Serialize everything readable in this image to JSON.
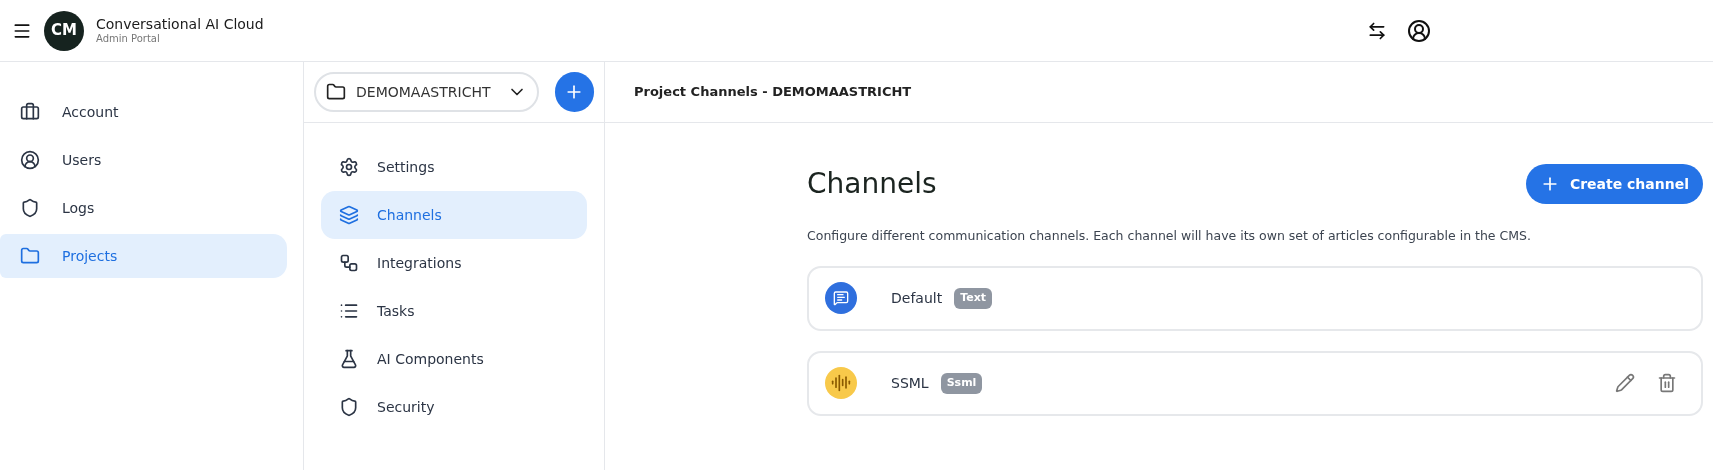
{
  "header": {
    "title": "Conversational AI Cloud",
    "subtitle": "Admin Portal",
    "logo": "CM"
  },
  "sidebar": {
    "items": [
      {
        "label": "Account",
        "kind": "briefcase",
        "selected": false
      },
      {
        "label": "Users",
        "kind": "user",
        "selected": false
      },
      {
        "label": "Logs",
        "kind": "shield",
        "selected": false
      },
      {
        "label": "Projects",
        "kind": "folder",
        "selected": true
      }
    ]
  },
  "project_selector": {
    "value": "DEMOMAASTRICHT"
  },
  "project_menu": {
    "items": [
      {
        "label": "Settings",
        "kind": "gear",
        "selected": false
      },
      {
        "label": "Channels",
        "kind": "layers",
        "selected": true
      },
      {
        "label": "Integrations",
        "kind": "nodes",
        "selected": false
      },
      {
        "label": "Tasks",
        "kind": "list",
        "selected": false
      },
      {
        "label": "AI Components",
        "kind": "flask",
        "selected": false
      },
      {
        "label": "Security",
        "kind": "shield",
        "selected": false
      }
    ]
  },
  "breadcrumb": "Project Channels - DEMOMAASTRICHT",
  "page": {
    "heading": "Channels",
    "create_button": "Create channel",
    "description": "Configure different communication channels. Each channel will have its own set of articles configurable in the CMS."
  },
  "channels": [
    {
      "name": "Default",
      "tag": "Text",
      "kind": "text",
      "color": "#2f6fde",
      "actions": false
    },
    {
      "name": "SSML",
      "tag": "Ssml",
      "kind": "voice",
      "color": "#f8c94a",
      "actions": true
    }
  ]
}
